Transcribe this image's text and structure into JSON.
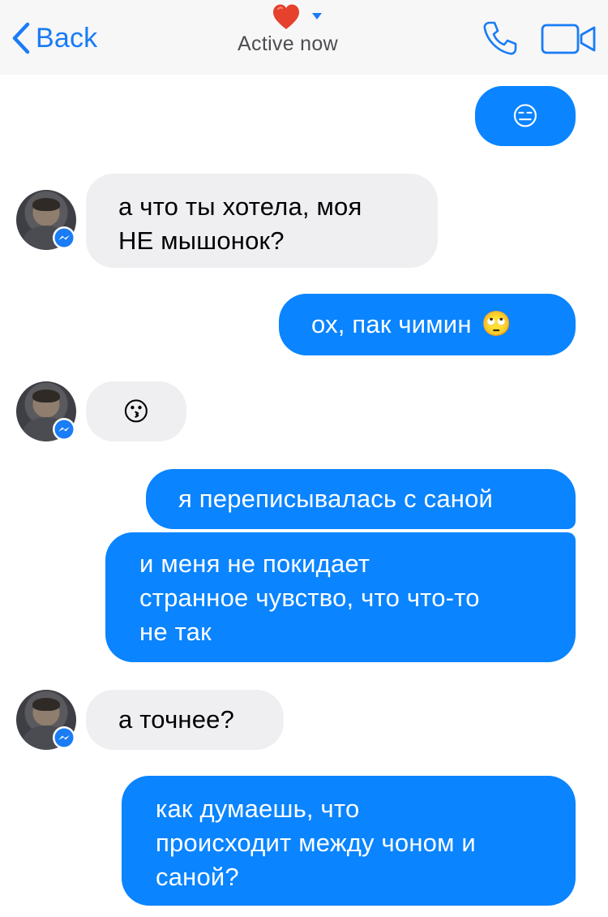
{
  "header": {
    "back_label": "Back",
    "status": "Active now",
    "icons": {
      "heart": "heart-icon",
      "caret": "caret-down-icon",
      "phone": "phone-icon",
      "video": "video-camera-icon"
    },
    "accent_color": "#1a7cf6"
  },
  "messages": [
    {
      "sender": "me",
      "emoji": "😑"
    },
    {
      "sender": "contact",
      "lines": [
        "а что ты хотела, моя",
        "НЕ мышонок?"
      ]
    },
    {
      "sender": "me",
      "text": "ох, пак чимин",
      "emoji": "🙄"
    },
    {
      "sender": "contact",
      "emoji": "😗"
    },
    {
      "sender": "me",
      "text": "я переписывалась с саной"
    },
    {
      "sender": "me",
      "lines": [
        "и меня не покидает",
        "странное чувство, что что-то",
        "не так"
      ]
    },
    {
      "sender": "contact",
      "text": "а точнее?"
    },
    {
      "sender": "me",
      "lines": [
        "как думаешь, что",
        "происходит между чоном и",
        "саной?"
      ]
    }
  ],
  "colors": {
    "outgoing_bubble": "#0a84ff",
    "incoming_bubble": "#efeff2",
    "messenger_badge": "#1a7cf6"
  }
}
